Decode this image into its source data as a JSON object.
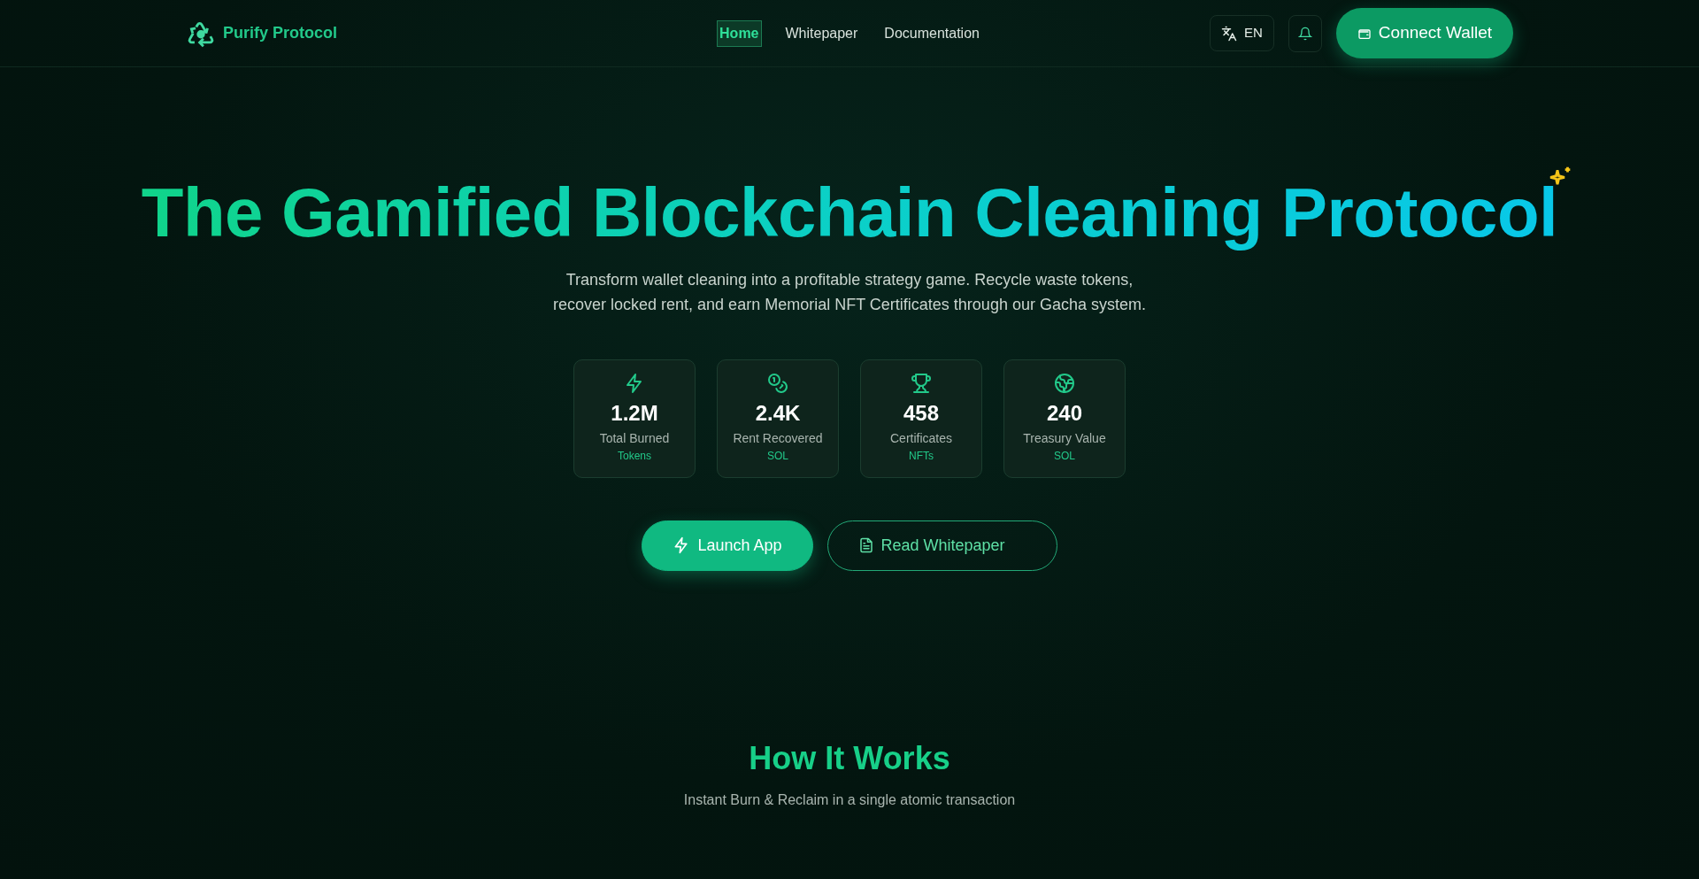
{
  "brand": {
    "name": "Purify Protocol"
  },
  "nav": [
    {
      "label": "Home",
      "selected": true
    },
    {
      "label": "Whitepaper",
      "selected": false
    },
    {
      "label": "Documentation",
      "selected": false
    }
  ],
  "language": {
    "label": "EN"
  },
  "connect_button": {
    "label": "Connect Wallet"
  },
  "hero": {
    "title": "The Gamified Blockchain Cleaning Protocol",
    "subtitle": "Transform wallet cleaning into a profitable strategy game. Recycle waste tokens, recover locked rent, and earn Memorial NFT Certificates through our Gacha system."
  },
  "stats": [
    {
      "value": "1.2M",
      "label": "Total Burned",
      "unit": "Tokens"
    },
    {
      "value": "2.4K",
      "label": "Rent Recovered",
      "unit": "SOL"
    },
    {
      "value": "458",
      "label": "Certificates",
      "unit": "NFTs"
    },
    {
      "value": "240",
      "label": "Treasury Value",
      "unit": "SOL"
    }
  ],
  "actions": [
    {
      "label": "Launch App",
      "kind": "primary"
    },
    {
      "label": "Read Whitepaper",
      "kind": "outline"
    }
  ],
  "how_it_works": {
    "title": "How It Works",
    "subtitle": "Instant Burn & Reclaim in a single atomic transaction"
  }
}
